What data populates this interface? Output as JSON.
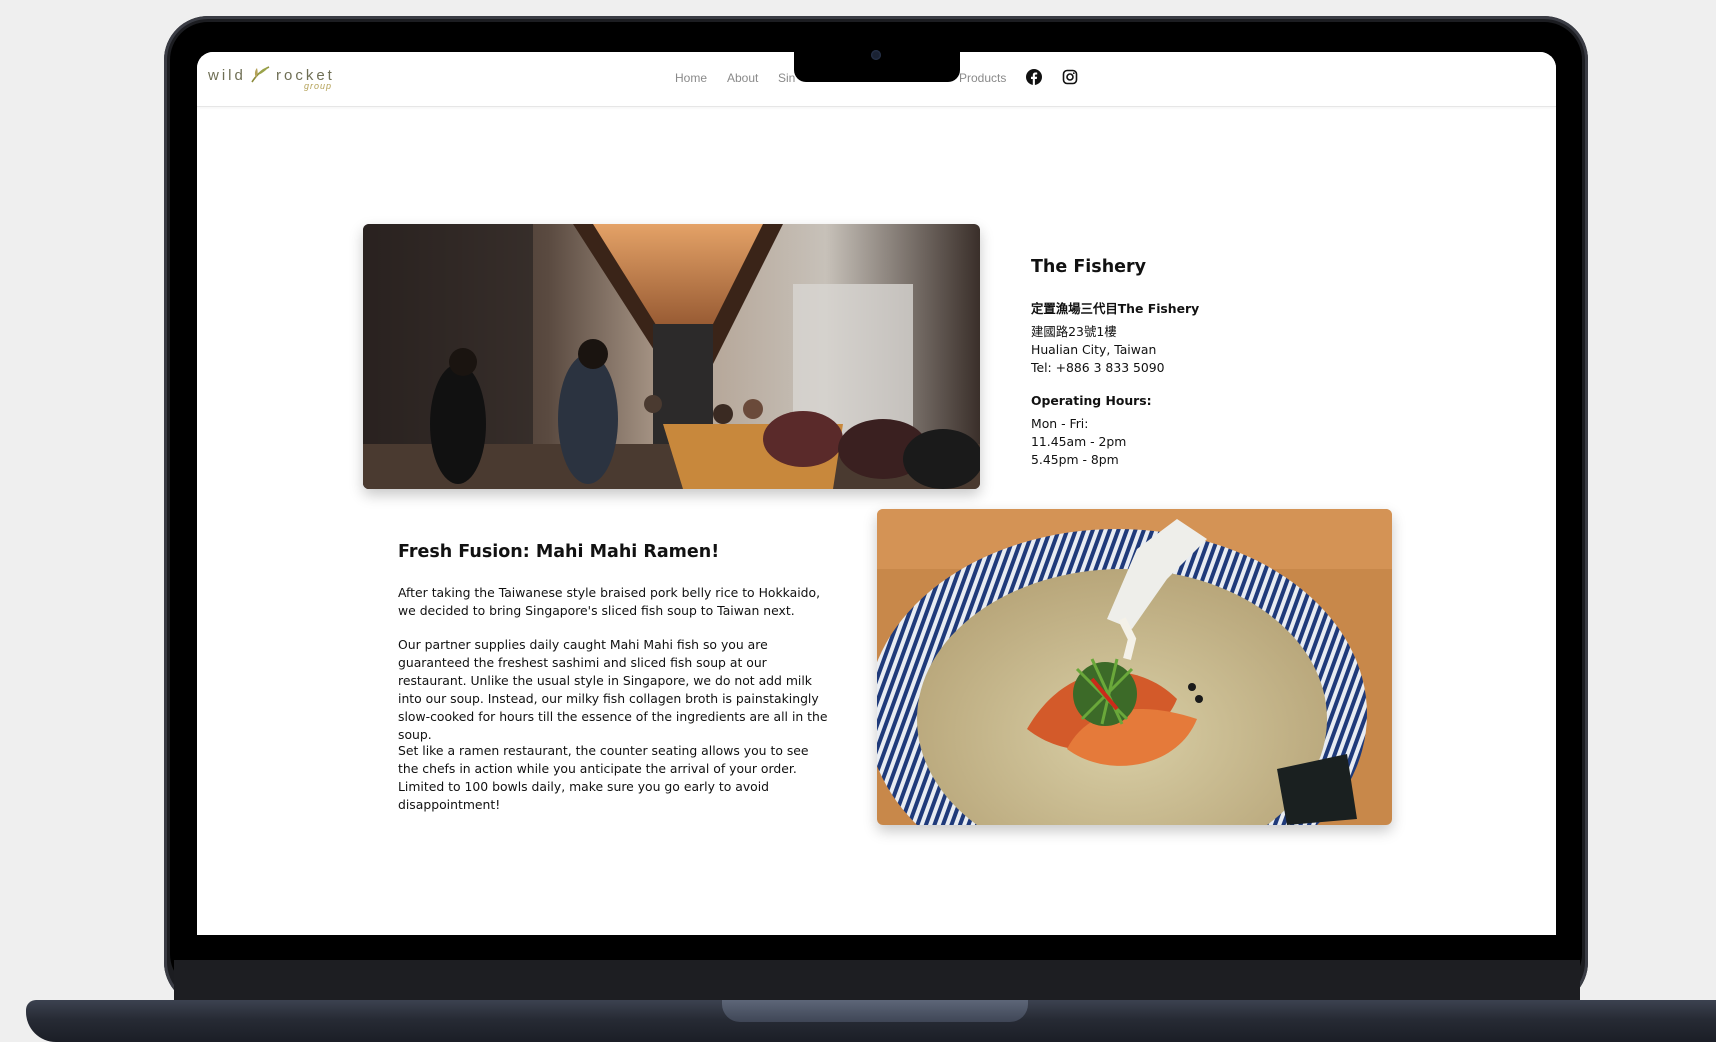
{
  "header": {
    "logo": {
      "word1": "wild",
      "word2": "rocket",
      "sub": "group"
    },
    "nav": {
      "home": "Home",
      "about": "About",
      "sin_partial": "Sin",
      "products_partial": "Products",
      "facebook_icon": "facebook-icon",
      "instagram_icon": "instagram-icon"
    }
  },
  "restaurant": {
    "name": "The Fishery",
    "address_title": "定置漁場三代目The Fishery",
    "address_line1": "建國路23號1樓",
    "address_line2": "Hualian City, Taiwan",
    "tel": "Tel: +886 3 833 5090",
    "hours_title": "Operating Hours:",
    "hours_days": "Mon - Fri:",
    "hours_lunch": "11.45am - 2pm",
    "hours_dinner": "5.45pm - 8pm"
  },
  "feature": {
    "title": "Fresh Fusion: Mahi Mahi Ramen!",
    "paragraphs": [
      "After taking the Taiwanese style braised pork belly rice to Hokkaido, we decided to bring Singapore's sliced fish soup to Taiwan next.",
      "Our partner supplies daily caught Mahi Mahi fish so you are guaranteed the freshest sashimi and sliced fish soup at our restaurant. Unlike the usual style in Singapore, we do not add milk into our soup. Instead, our milky fish collagen broth is painstakingly slow-cooked for hours till the essence of the ingredients are all in the soup.",
      "Set like a ramen restaurant, the counter seating allows you to see the chefs in action while you anticipate the arrival of your order. Limited to 100 bowls daily, make sure you go early to avoid disappointment!"
    ]
  },
  "colors": {
    "logo_text": "#6f6f55",
    "logo_accent": "#b5a35a",
    "nav_text": "#8a8a8a",
    "body_text": "#111111"
  }
}
